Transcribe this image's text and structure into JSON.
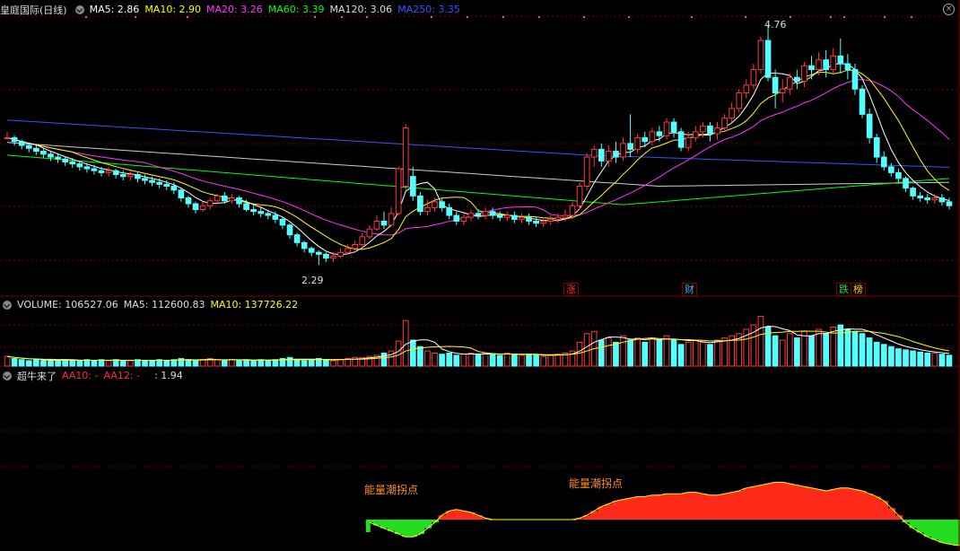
{
  "price_header": {
    "stock_name": "皇庭国际(日线)",
    "ma5": "MA5: 2.86",
    "ma10": "MA10: 2.90",
    "ma20": "MA20: 3.26",
    "ma60": "MA60: 3.39",
    "ma120": "MA120: 3.06",
    "ma250": "MA250: 3.35"
  },
  "volume_header": {
    "volume": "VOLUME: 106527.06",
    "ma5": "MA5: 112600.83",
    "ma10": "MA10: 137726.22"
  },
  "indicator_header": {
    "name": "超牛来了",
    "aa10": "AA10: -",
    "aa12": "AA12: -",
    "value": ": 1.94"
  },
  "annotations": {
    "high_label": "4.76",
    "low_label": "2.29",
    "energy_label_1": "能量潮拐点",
    "energy_label_2": "能量潮拐点"
  },
  "event_tags": [
    {
      "text": "涨",
      "color": "#ff3030"
    },
    {
      "text": "财",
      "color": "#4aa8ff"
    },
    {
      "text": "跌",
      "color": "#2cd62c"
    },
    {
      "text": "榜",
      "color": "#ffcc00"
    }
  ],
  "colors": {
    "up": "#ff3a3a",
    "down": "#54ffff",
    "ma5": "#ffffff",
    "ma10": "#ffff00",
    "ma20": "#ff33ff",
    "ma60": "#00ff00",
    "ma120": "#cccccc",
    "ma250": "#3355ff",
    "grid": "#7a0000",
    "energy_up": "#ff2a1a",
    "energy_down": "#22dd22"
  },
  "chart_data": {
    "type": "candlestick",
    "title": "皇庭国际(日线)",
    "price_range": [
      2.0,
      5.0
    ],
    "high": 4.76,
    "low": 2.29,
    "candles": [
      [
        3.6,
        3.6,
        3.58,
        3.66
      ],
      [
        3.6,
        3.56,
        3.52,
        3.62
      ],
      [
        3.56,
        3.52,
        3.48,
        3.58
      ],
      [
        3.52,
        3.49,
        3.45,
        3.55
      ],
      [
        3.49,
        3.46,
        3.42,
        3.52
      ],
      [
        3.46,
        3.43,
        3.39,
        3.49
      ],
      [
        3.43,
        3.4,
        3.36,
        3.46
      ],
      [
        3.4,
        3.38,
        3.34,
        3.44
      ],
      [
        3.38,
        3.35,
        3.31,
        3.41
      ],
      [
        3.35,
        3.33,
        3.29,
        3.39
      ],
      [
        3.33,
        3.3,
        3.26,
        3.36
      ],
      [
        3.3,
        3.28,
        3.24,
        3.34
      ],
      [
        3.28,
        3.26,
        3.22,
        3.32
      ],
      [
        3.26,
        3.24,
        3.2,
        3.3
      ],
      [
        3.24,
        3.26,
        3.2,
        3.3
      ],
      [
        3.26,
        3.22,
        3.18,
        3.28
      ],
      [
        3.22,
        3.2,
        3.16,
        3.26
      ],
      [
        3.2,
        3.22,
        3.16,
        3.26
      ],
      [
        3.22,
        3.18,
        3.14,
        3.24
      ],
      [
        3.18,
        3.16,
        3.12,
        3.22
      ],
      [
        3.16,
        3.14,
        3.1,
        3.2
      ],
      [
        3.14,
        3.12,
        3.08,
        3.18
      ],
      [
        3.12,
        3.1,
        3.06,
        3.16
      ],
      [
        3.1,
        3.06,
        3.02,
        3.14
      ],
      [
        3.06,
        2.98,
        2.94,
        3.08
      ],
      [
        2.98,
        2.92,
        2.88,
        3.0
      ],
      [
        2.92,
        2.86,
        2.82,
        2.94
      ],
      [
        2.86,
        2.9,
        2.84,
        2.94
      ],
      [
        2.9,
        2.95,
        2.86,
        2.98
      ],
      [
        2.95,
        3.0,
        2.92,
        3.02
      ],
      [
        3.0,
        2.95,
        2.92,
        3.04
      ],
      [
        2.95,
        2.98,
        2.92,
        3.02
      ],
      [
        2.98,
        2.92,
        2.88,
        3.0
      ],
      [
        2.92,
        2.86,
        2.84,
        2.96
      ],
      [
        2.86,
        2.84,
        2.8,
        2.9
      ],
      [
        2.84,
        2.82,
        2.78,
        2.88
      ],
      [
        2.82,
        2.8,
        2.76,
        2.86
      ],
      [
        2.8,
        2.76,
        2.72,
        2.84
      ],
      [
        2.76,
        2.7,
        2.66,
        2.78
      ],
      [
        2.7,
        2.6,
        2.56,
        2.72
      ],
      [
        2.6,
        2.52,
        2.48,
        2.62
      ],
      [
        2.52,
        2.46,
        2.42,
        2.54
      ],
      [
        2.46,
        2.42,
        2.38,
        2.48
      ],
      [
        2.42,
        2.4,
        2.29,
        2.44
      ],
      [
        2.4,
        2.36,
        2.32,
        2.42
      ],
      [
        2.36,
        2.38,
        2.32,
        2.42
      ],
      [
        2.38,
        2.42,
        2.36,
        2.46
      ],
      [
        2.42,
        2.46,
        2.4,
        2.5
      ],
      [
        2.46,
        2.5,
        2.44,
        2.54
      ],
      [
        2.5,
        2.58,
        2.48,
        2.62
      ],
      [
        2.58,
        2.66,
        2.56,
        2.7
      ],
      [
        2.66,
        2.74,
        2.64,
        2.8
      ],
      [
        2.74,
        2.7,
        2.66,
        2.84
      ],
      [
        2.7,
        2.82,
        2.68,
        2.88
      ],
      [
        2.82,
        3.28,
        2.8,
        3.3
      ],
      [
        3.1,
        3.7,
        3.05,
        3.74
      ],
      [
        3.2,
        3.0,
        2.95,
        3.3
      ],
      [
        3.0,
        2.84,
        2.8,
        3.04
      ],
      [
        2.84,
        2.88,
        2.8,
        2.96
      ],
      [
        2.88,
        2.94,
        2.84,
        2.98
      ],
      [
        2.94,
        2.88,
        2.84,
        2.98
      ],
      [
        2.88,
        2.8,
        2.76,
        2.92
      ],
      [
        2.8,
        2.74,
        2.7,
        2.84
      ],
      [
        2.74,
        2.78,
        2.7,
        2.82
      ],
      [
        2.78,
        2.82,
        2.74,
        2.86
      ],
      [
        2.82,
        2.8,
        2.76,
        2.86
      ],
      [
        2.8,
        2.84,
        2.76,
        2.88
      ],
      [
        2.84,
        2.8,
        2.76,
        2.88
      ],
      [
        2.8,
        2.78,
        2.74,
        2.84
      ],
      [
        2.78,
        2.8,
        2.74,
        2.84
      ],
      [
        2.8,
        2.76,
        2.72,
        2.84
      ],
      [
        2.76,
        2.78,
        2.72,
        2.82
      ],
      [
        2.78,
        2.74,
        2.7,
        2.82
      ],
      [
        2.74,
        2.72,
        2.68,
        2.78
      ],
      [
        2.72,
        2.74,
        2.68,
        2.78
      ],
      [
        2.74,
        2.76,
        2.7,
        2.8
      ],
      [
        2.76,
        2.78,
        2.72,
        2.82
      ],
      [
        2.78,
        2.8,
        2.74,
        2.86
      ],
      [
        2.8,
        2.9,
        2.76,
        2.94
      ],
      [
        2.9,
        3.1,
        2.86,
        3.14
      ],
      [
        3.1,
        3.4,
        3.06,
        3.44
      ],
      [
        3.4,
        3.48,
        3.3,
        3.52
      ],
      [
        3.48,
        3.36,
        3.3,
        3.54
      ],
      [
        3.36,
        3.46,
        3.3,
        3.52
      ],
      [
        3.46,
        3.4,
        3.34,
        3.56
      ],
      [
        3.4,
        3.54,
        3.36,
        3.6
      ],
      [
        3.54,
        3.48,
        3.4,
        3.84
      ],
      [
        3.48,
        3.6,
        3.44,
        3.64
      ],
      [
        3.6,
        3.56,
        3.5,
        3.66
      ],
      [
        3.56,
        3.66,
        3.52,
        3.7
      ],
      [
        3.66,
        3.62,
        3.56,
        3.72
      ],
      [
        3.62,
        3.76,
        3.58,
        3.8
      ],
      [
        3.76,
        3.66,
        3.6,
        3.8
      ],
      [
        3.66,
        3.5,
        3.46,
        3.7
      ],
      [
        3.5,
        3.6,
        3.46,
        3.66
      ],
      [
        3.6,
        3.66,
        3.56,
        3.72
      ],
      [
        3.66,
        3.72,
        3.6,
        3.76
      ],
      [
        3.72,
        3.64,
        3.56,
        3.76
      ],
      [
        3.64,
        3.7,
        3.58,
        3.76
      ],
      [
        3.7,
        3.8,
        3.66,
        3.84
      ],
      [
        3.8,
        3.9,
        3.76,
        3.96
      ],
      [
        3.9,
        4.06,
        3.86,
        4.1
      ],
      [
        4.06,
        4.14,
        4.0,
        4.2
      ],
      [
        4.14,
        4.3,
        4.1,
        4.36
      ],
      [
        4.3,
        4.6,
        4.26,
        4.64
      ],
      [
        4.6,
        4.22,
        4.18,
        4.76
      ],
      [
        4.22,
        4.06,
        3.9,
        4.3
      ],
      [
        4.06,
        4.1,
        3.96,
        4.2
      ],
      [
        4.1,
        4.22,
        4.04,
        4.26
      ],
      [
        4.22,
        4.18,
        4.1,
        4.3
      ],
      [
        4.18,
        4.34,
        4.12,
        4.38
      ],
      [
        4.34,
        4.3,
        4.2,
        4.44
      ],
      [
        4.3,
        4.4,
        4.24,
        4.48
      ],
      [
        4.4,
        4.3,
        4.22,
        4.5
      ],
      [
        4.3,
        4.44,
        4.26,
        4.52
      ],
      [
        4.44,
        4.36,
        4.26,
        4.62
      ],
      [
        4.36,
        4.3,
        4.2,
        4.46
      ],
      [
        4.3,
        4.1,
        4.04,
        4.36
      ],
      [
        4.1,
        3.84,
        3.8,
        4.14
      ],
      [
        3.84,
        3.6,
        3.54,
        3.9
      ],
      [
        3.6,
        3.4,
        3.34,
        3.64
      ],
      [
        3.4,
        3.3,
        3.26,
        3.46
      ],
      [
        3.3,
        3.24,
        3.2,
        3.34
      ],
      [
        3.24,
        3.18,
        3.14,
        3.28
      ],
      [
        3.18,
        3.08,
        3.04,
        3.2
      ],
      [
        3.08,
        3.0,
        2.96,
        3.1
      ],
      [
        3.0,
        2.98,
        2.94,
        3.04
      ],
      [
        2.98,
        2.96,
        2.92,
        3.02
      ],
      [
        2.96,
        2.98,
        2.92,
        3.02
      ],
      [
        2.98,
        2.94,
        2.9,
        3.02
      ],
      [
        2.94,
        2.9,
        2.86,
        2.98
      ]
    ],
    "volumes": [
      9,
      7,
      6,
      5,
      6,
      5,
      6,
      5,
      6,
      5,
      5,
      6,
      5,
      6,
      5,
      6,
      5,
      5,
      6,
      5,
      5,
      6,
      5,
      6,
      7,
      6,
      5,
      6,
      7,
      6,
      5,
      6,
      5,
      6,
      5,
      6,
      5,
      6,
      7,
      8,
      6,
      5,
      6,
      7,
      6,
      5,
      6,
      7,
      8,
      8,
      9,
      10,
      12,
      14,
      23,
      42,
      24,
      18,
      14,
      12,
      11,
      12,
      10,
      11,
      12,
      11,
      12,
      11,
      10,
      12,
      11,
      10,
      11,
      10,
      9,
      10,
      11,
      12,
      14,
      22,
      30,
      32,
      24,
      26,
      22,
      28,
      24,
      26,
      22,
      26,
      24,
      28,
      24,
      20,
      22,
      24,
      22,
      20,
      24,
      26,
      28,
      30,
      34,
      38,
      46,
      36,
      28,
      24,
      30,
      26,
      32,
      28,
      34,
      30,
      36,
      38,
      34,
      32,
      30,
      26,
      22,
      20,
      18,
      16,
      15,
      14,
      13,
      12,
      12,
      11,
      10
    ],
    "energy": [
      0,
      0,
      0,
      0,
      0,
      0,
      0,
      0,
      0,
      0,
      0,
      0,
      0,
      0,
      0,
      0,
      0,
      0,
      0,
      0,
      0,
      0,
      0,
      0,
      0,
      0,
      0,
      0,
      0,
      0,
      0,
      0,
      0,
      0,
      0,
      0,
      0,
      0,
      0,
      0,
      0,
      0,
      0,
      0,
      0,
      0,
      0,
      0,
      0,
      0,
      -2,
      -4,
      -6,
      -8,
      -10,
      -12,
      -12,
      -10,
      -6,
      -2,
      3,
      6,
      7,
      6,
      5,
      3,
      1,
      0,
      0,
      0,
      0,
      0,
      0,
      0,
      0,
      0,
      0,
      0,
      0,
      1,
      3,
      6,
      9,
      11,
      13,
      14,
      15,
      16,
      16,
      17,
      17,
      18,
      18,
      18,
      19,
      19,
      18,
      17,
      17,
      18,
      19,
      20,
      22,
      23,
      24,
      25,
      26,
      26,
      25,
      24,
      23,
      22,
      21,
      20,
      21,
      22,
      22,
      21,
      20,
      18,
      16,
      13,
      8,
      3,
      -2,
      -6,
      -9,
      -12,
      -14,
      -16,
      -17,
      -18,
      -18,
      -18,
      -18
    ]
  }
}
